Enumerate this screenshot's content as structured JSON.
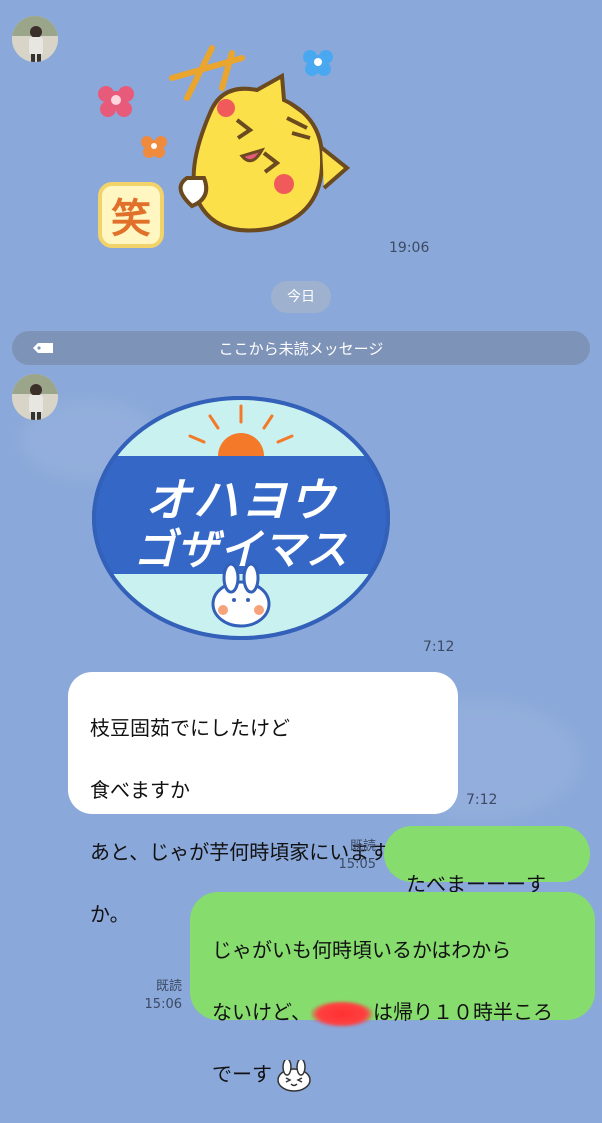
{
  "chat": {
    "sticker1_time": "19:06",
    "date_pill": "今日",
    "unread_label": "ここから未読メッセージ",
    "sticker2": {
      "text_line1": "オハヨウ",
      "text_line2": "ゴザイマス",
      "time": "7:12"
    },
    "sticker1_text": "笑",
    "message1": {
      "lines": [
        "枝豆固茹でにしたけど",
        "食べますか",
        "あと、じゃが芋何時頃家にいます",
        "か。"
      ],
      "time": "7:12"
    },
    "message2": {
      "text": "たべまーーーす",
      "read": "既読",
      "time": "15:05"
    },
    "message3": {
      "line1": "じゃがいも何時頃いるかはわから",
      "line2_pre": "ないけど、",
      "line2_post": "は帰り１０時半ころ",
      "line3": "でーす",
      "read": "既読",
      "time": "15:06"
    }
  },
  "colors": {
    "background": "#8aa8d9",
    "incoming_bubble": "#ffffff",
    "outgoing_bubble": "#86dd6e",
    "unread_bar": "#7e93b8"
  }
}
